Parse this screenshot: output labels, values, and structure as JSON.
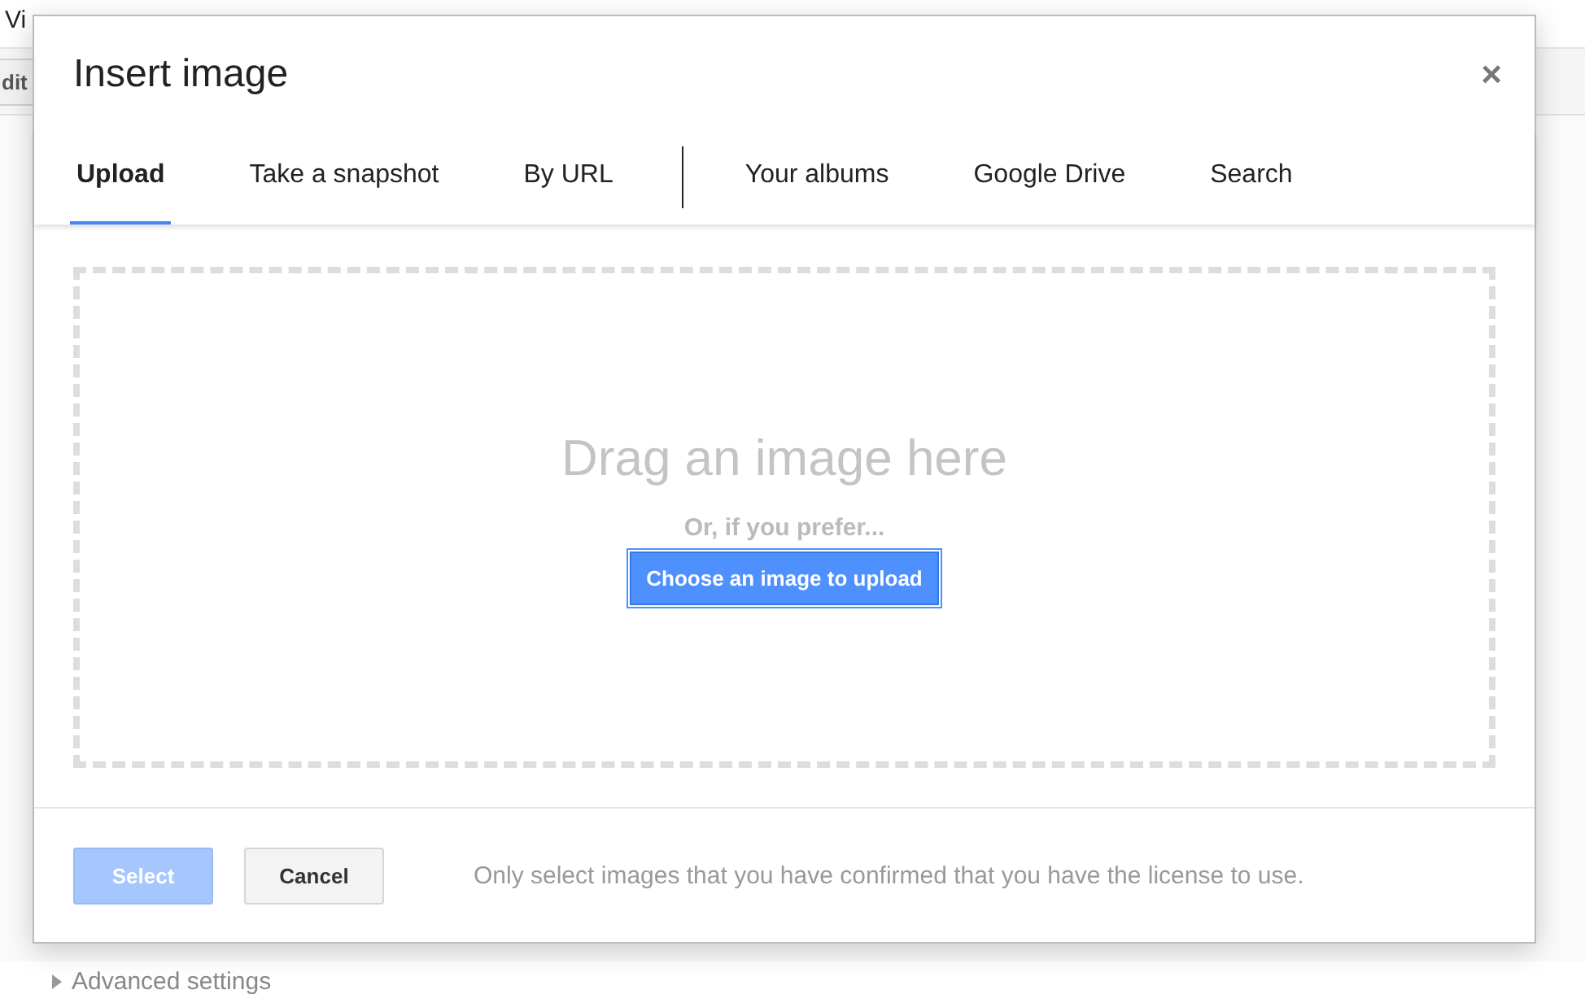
{
  "background": {
    "menu_text": "Vi",
    "toolbar_button": "dit",
    "advanced_settings": "Advanced settings"
  },
  "dialog": {
    "title": "Insert image",
    "close": "×",
    "tab_groups": [
      [
        {
          "label": "Upload",
          "selected": true
        },
        {
          "label": "Take a snapshot",
          "selected": false
        },
        {
          "label": "By URL",
          "selected": false
        }
      ],
      [
        {
          "label": "Your albums",
          "selected": false
        },
        {
          "label": "Google Drive",
          "selected": false
        },
        {
          "label": "Search",
          "selected": false
        }
      ]
    ],
    "drop_zone": {
      "heading": "Drag an image here",
      "subtext": "Or, if you prefer...",
      "button": "Choose an image to upload"
    },
    "footer": {
      "buttons": [
        {
          "label": "Select",
          "kind": "primary",
          "disabled": true
        },
        {
          "label": "Cancel",
          "kind": "secondary",
          "disabled": false
        }
      ],
      "note": "Only select images that you have confirmed that you have the license to use."
    }
  }
}
